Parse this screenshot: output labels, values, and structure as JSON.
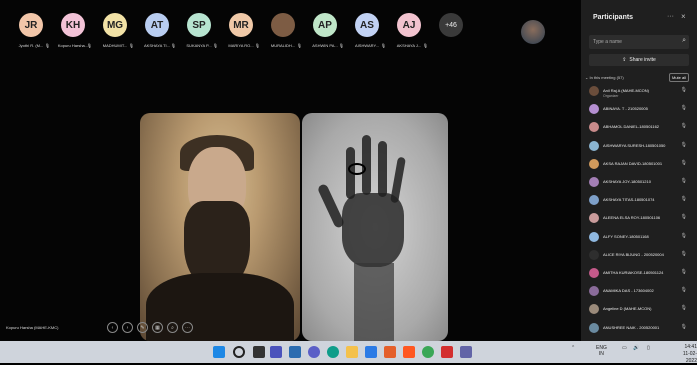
{
  "participants_strip": [
    {
      "initials": "JR",
      "name": "Jyothi R. (M...",
      "color": "#f2c6a9"
    },
    {
      "initials": "KH",
      "name": "Kopuru Harsha...",
      "color": "#f3c3d7"
    },
    {
      "initials": "MG",
      "name": "MADHUMIT...",
      "color": "#f2e2a6"
    },
    {
      "initials": "AT",
      "name": "AKSHAYA TI...",
      "color": "#b9cdf1"
    },
    {
      "initials": "SP",
      "name": "SUKANYA P...",
      "color": "#b7e4d0"
    },
    {
      "initials": "MR",
      "name": "MARIYA RO...",
      "color": "#f0c9a8"
    },
    {
      "initials": "",
      "name": "MURALIDH...",
      "color": "#7d5c44"
    },
    {
      "initials": "AP",
      "name": "ASHWIN PA...",
      "color": "#bfe6c8"
    },
    {
      "initials": "AS",
      "name": "AISHWARY...",
      "color": "#c2d2f4"
    },
    {
      "initials": "AJ",
      "name": "AKSHAYA J...",
      "color": "#f2c3cf"
    }
  ],
  "overflow_count": "+46",
  "presenter_label": "Kopuru Harsha (MAHE-KMC)",
  "panel": {
    "title": "Participants",
    "search_placeholder": "Type a name",
    "share_invite": "Share invite",
    "section_label": "In this meeting (57)",
    "mute_all": "Mute all",
    "people": [
      {
        "name": "Anil Raj A (MAHE-MCON)",
        "role": "Organizer",
        "color": "#6a4d3b"
      },
      {
        "name": "ABINAYA. T - 210520005",
        "role": "",
        "color": "#b58fd1"
      },
      {
        "name": "ABHAMOL DANIEL-180501162",
        "role": "",
        "color": "#c98b8b"
      },
      {
        "name": "AISHWARYA SURESH-180501050",
        "role": "",
        "color": "#8bb5d1"
      },
      {
        "name": "AKSA RAJAN DAVID-180501001",
        "role": "",
        "color": "#d19a5c"
      },
      {
        "name": "AKSHAYA JOY-180501210",
        "role": "",
        "color": "#a37eb5"
      },
      {
        "name": "AKSHAYA TITAS-180501074",
        "role": "",
        "color": "#7ea0c9"
      },
      {
        "name": "ALEENA ELSA ROY-180501106",
        "role": "",
        "color": "#c99b9b"
      },
      {
        "name": "ALFY SONEY-180501168",
        "role": "",
        "color": "#8fb8e0"
      },
      {
        "name": "ALICE RIYA BIJUNG - 200520004",
        "role": "",
        "color": "#2e2e2e"
      },
      {
        "name": "AMITHA KURIAKOSE-180501124",
        "role": "",
        "color": "#c45a8a"
      },
      {
        "name": "ANAMIKA DAS - 173604002",
        "role": "",
        "color": "#8a6b9a"
      },
      {
        "name": "Angeline D (MAHE-MCON)",
        "role": "",
        "color": "#9a8a7a"
      },
      {
        "name": "ANUSHREE NAIK - 200520001",
        "role": "",
        "color": "#6a8aa0"
      }
    ]
  },
  "taskbar": {
    "lang_line1": "ENG",
    "lang_line2": "IN",
    "time": "14:41",
    "date": "11-02-2022"
  }
}
